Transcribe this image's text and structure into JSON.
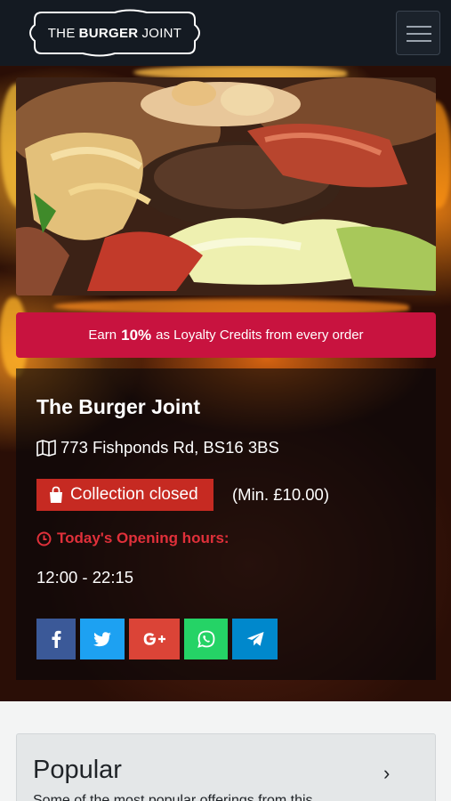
{
  "header": {
    "logo_prefix": "THE",
    "logo_bold": "BURGER",
    "logo_suffix": "JOINT",
    "menu_icon": "hamburger-menu-icon"
  },
  "hero": {
    "image_subject": "burger"
  },
  "loyalty": {
    "prefix": "Earn",
    "percent": "10%",
    "suffix": "as Loyalty Credits from every order",
    "color": "#c8133f"
  },
  "restaurant": {
    "name": "The Burger Joint",
    "address_icon": "map-icon",
    "address": "773 Fishponds Rd, BS16 3BS",
    "status": "Collection closed",
    "status_icon": "shopping-bag-icon",
    "status_color": "#c62a22",
    "min_order": "(Min. £10.00)",
    "hours_icon": "clock-icon",
    "hours_title": "Today's Opening hours:",
    "hours": "12:00 - 22:15"
  },
  "social": [
    {
      "name": "facebook",
      "glyph": "f",
      "color": "#3b5998"
    },
    {
      "name": "twitter",
      "glyph": "t",
      "color": "#1da1f2"
    },
    {
      "name": "google-plus",
      "glyph": "G+",
      "color": "#db4437"
    },
    {
      "name": "whatsapp",
      "glyph": "w",
      "color": "#25d366"
    },
    {
      "name": "telegram",
      "glyph": "p",
      "color": "#0088cc"
    }
  ],
  "popular": {
    "title": "Popular",
    "chevron": "›",
    "description": "Some of the most popular offerings from this"
  }
}
